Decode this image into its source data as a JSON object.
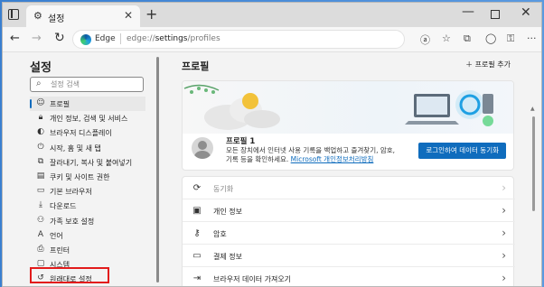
{
  "browser": {
    "tab_title": "설정",
    "tab_icon": "gear-icon",
    "new_tab": "+",
    "address_brand": "Edge",
    "address_url_prefix": "edge://",
    "address_url_bold": "settings",
    "address_url_suffix": "/profiles"
  },
  "sidebar": {
    "title": "설정",
    "search_placeholder": "설정 검색",
    "items": [
      {
        "label": "프로필",
        "icon": "user-icon",
        "active": true
      },
      {
        "label": "개인 정보, 검색 및 서비스",
        "icon": "lock-icon"
      },
      {
        "label": "브라우저 디스플레이",
        "icon": "brush-icon"
      },
      {
        "label": "시작, 홈 및 새 탭",
        "icon": "power-icon"
      },
      {
        "label": "잘라내기, 복사 및 붙여넣기",
        "icon": "share-icon"
      },
      {
        "label": "쿠키 및 사이트 권한",
        "icon": "cookie-icon"
      },
      {
        "label": "기본 브라우저",
        "icon": "browser-icon"
      },
      {
        "label": "다운로드",
        "icon": "download-icon"
      },
      {
        "label": "가족 보호 설정",
        "icon": "family-icon"
      },
      {
        "label": "언어",
        "icon": "language-icon"
      },
      {
        "label": "프린터",
        "icon": "printer-icon"
      },
      {
        "label": "시스템",
        "icon": "system-icon"
      },
      {
        "label": "원래대로 설정",
        "icon": "reset-icon"
      }
    ]
  },
  "main": {
    "title": "프로필",
    "add_profile": "프로필 추가",
    "profile": {
      "name": "프로필 1",
      "desc_line1": "모든 장치에서 인터넷 사용 기록을 백업하고 즐겨찾기, 암호,",
      "desc_line2": "기록 등을 확인하세요.",
      "desc_link": "Microsoft 개인정보처리방침",
      "sync_button": "로그인하여 데이터 동기화"
    },
    "rows": [
      {
        "label": "동기화",
        "icon": "sync-icon",
        "dim": true
      },
      {
        "label": "개인 정보",
        "icon": "id-card-icon"
      },
      {
        "label": "암호",
        "icon": "key-icon"
      },
      {
        "label": "결제 정보",
        "icon": "credit-card-icon"
      },
      {
        "label": "브라우저 데이터 가져오기",
        "icon": "import-icon"
      }
    ]
  },
  "colors": {
    "accent": "#0f6cbd",
    "highlight": "#e21b1b"
  }
}
